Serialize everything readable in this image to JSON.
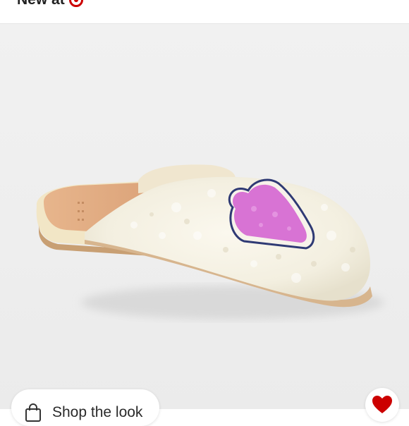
{
  "header": {
    "new_at_label": "New at",
    "brand_icon": "target-logo-icon",
    "brand_color": "#cc0000"
  },
  "product_image": {
    "subject": "slipper-photo"
  },
  "actions": {
    "shop_the_look_label": "Shop the look",
    "shop_icon": "shopping-bag-icon",
    "like_icon": "heart-icon",
    "like_color": "#cc0000"
  }
}
